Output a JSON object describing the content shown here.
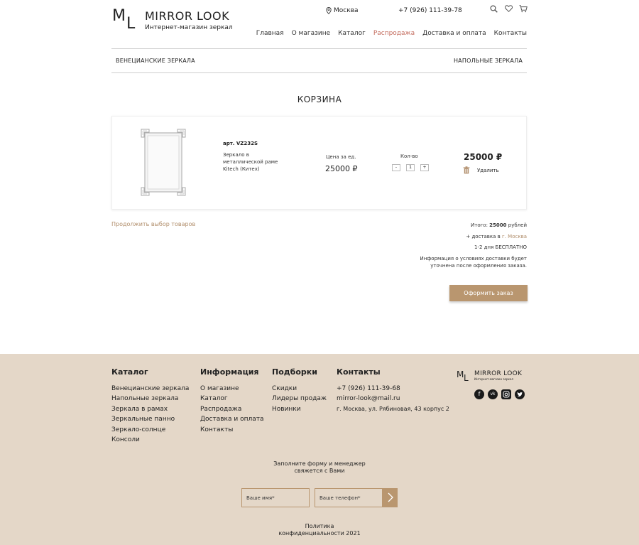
{
  "header": {
    "logo_m": "M",
    "logo_l": "L",
    "logo_title": "MIRROR LOOK",
    "logo_sub": "Интернет-магазин зеркал",
    "city": "Москва",
    "phone": "+7 (926) 111-39-78",
    "nav": [
      "Главная",
      "О магазине",
      "Каталог",
      "Распродажа",
      "Доставка и оплата",
      "Контакты"
    ],
    "nav_active": "Распродажа"
  },
  "subnav": {
    "left": "ВЕНЕЦИАНСКИЕ ЗЕРКАЛА",
    "right": "НАПОЛЬНЫЕ ЗЕРКАЛА"
  },
  "page_title": "КОРЗИНА",
  "cart": {
    "item": {
      "art": "арт. VZ232S",
      "desc": "Зеркало в металлической раме Kitech (Китех)",
      "price_label": "Цена за ед.",
      "price": "25000 ₽",
      "qty_label": "Кол-во",
      "qty_minus": "-",
      "qty": "1",
      "qty_plus": "+",
      "total": "25000 ₽",
      "delete": "Удалить"
    },
    "continue": "Продолжить выбор товаров",
    "summary": {
      "total_prefix": "Итого:",
      "total_value": "25000",
      "total_suffix": "рублей",
      "delivery_prefix": "+ доставка в",
      "delivery_city": "г. Москва",
      "delivery_terms": "1-2 дня БЕСПЛАТНО",
      "info": "Информация о условиях доставки будет уточнена после оформления заказа."
    },
    "order_button": "Оформить заказ"
  },
  "footer": {
    "catalog": {
      "title": "Каталог",
      "items": [
        "Венецианские зеркала",
        "Напольные зеркала",
        "Зеркала в рамах",
        "Зеркальные панно",
        "Зеркало-солнце",
        "Консоли"
      ]
    },
    "info": {
      "title": "Информация",
      "items": [
        "О магазине",
        "Каталог",
        "Распродажа",
        "Доставка и оплата",
        "Контакты"
      ]
    },
    "picks": {
      "title": "Подборки",
      "items": [
        "Скидки",
        "Лидеры продаж",
        "Новинки"
      ]
    },
    "contacts": {
      "title": "Контакты",
      "phone": "+7 (926) 111-39-68",
      "email": "mirror-look@mail.ru",
      "address": "г. Москва, ул. Рябиновая, 43 корпус 2"
    },
    "logo_title": "MIRROR LOOK",
    "logo_sub": "Интернет-магазин зеркал",
    "form_text_1": "Заполните форму и менеджер",
    "form_text_2": "свяжется с Вами",
    "name_placeholder": "Ваше имя*",
    "phone_placeholder": "Ваше телефон*",
    "policy_1": "Политика",
    "policy_2": "конфиденциальности 2021"
  },
  "colors": {
    "accent": "#b9966f",
    "nav_active": "#c36b5d",
    "footer_bg": "#e4d7c8"
  }
}
